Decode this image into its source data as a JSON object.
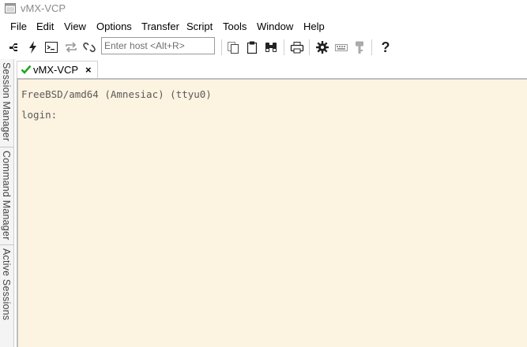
{
  "window": {
    "title": "vMX-VCP"
  },
  "menu": [
    "File",
    "Edit",
    "View",
    "Options",
    "Transfer",
    "Script",
    "Tools",
    "Window",
    "Help"
  ],
  "toolbar": {
    "host_placeholder": "Enter host <Alt+R>",
    "icons": [
      "connect-in-tab-icon",
      "quick-connect-icon",
      "terminal-icon",
      "reconnect-icon",
      "disconnect-icon",
      "copy-icon",
      "paste-icon",
      "find-icon",
      "print-icon",
      "settings-icon",
      "keymap-icon",
      "key-icon",
      "help-icon"
    ]
  },
  "tabs": [
    {
      "label": "vMX-VCP",
      "status": "connected",
      "close": "×"
    }
  ],
  "sidebar": {
    "tabs": [
      "Session Manager",
      "Command Manager",
      "Active Sessions"
    ]
  },
  "terminal": {
    "background": "#fdf3e1",
    "lines": [
      "FreeBSD/amd64 (Amnesiac) (ttyu0)",
      "login:"
    ]
  }
}
